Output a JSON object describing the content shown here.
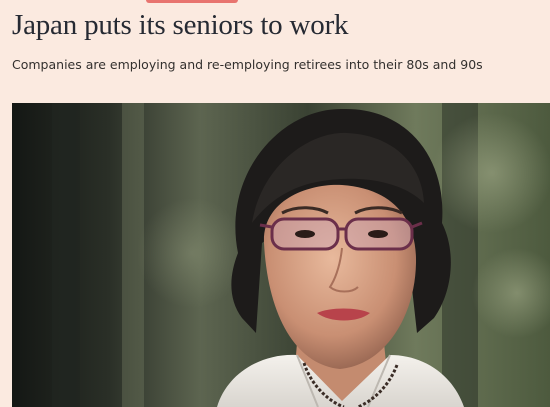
{
  "article": {
    "headline": "Japan puts its seniors to work",
    "standfirst": "Companies are employing and re-employing retirees into their 80s and 90s"
  },
  "colors": {
    "page_background": "#fbeae0",
    "headline_text": "#262a33",
    "accent_tag": "#e8746f"
  }
}
